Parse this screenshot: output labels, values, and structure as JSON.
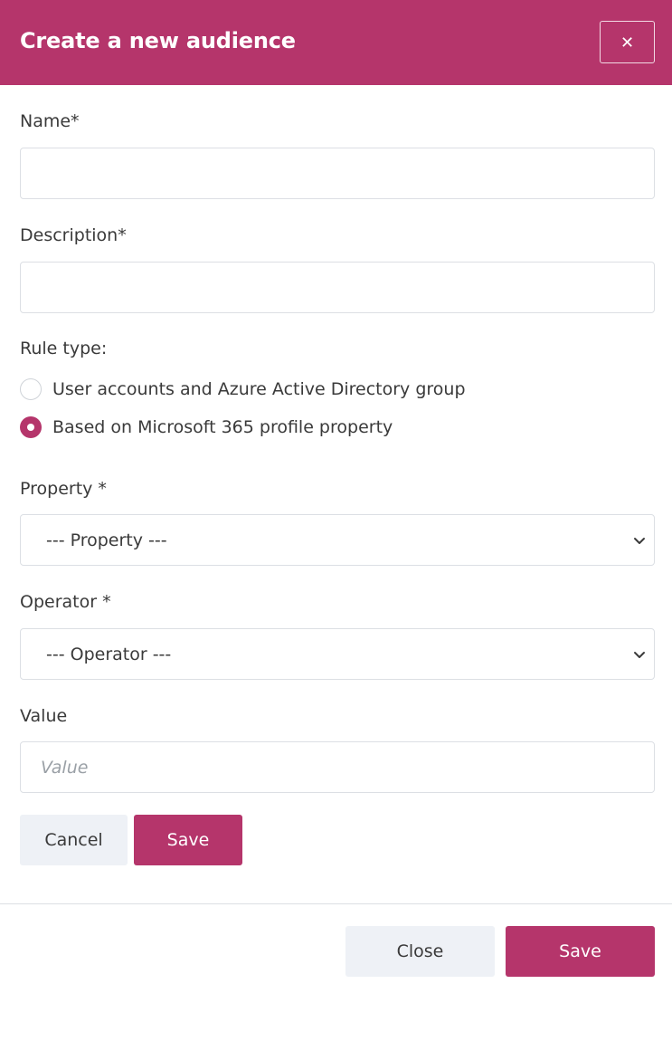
{
  "header": {
    "title": "Create a new audience",
    "close_glyph": "✕",
    "accent_color": "#b5356b"
  },
  "form": {
    "name": {
      "label": "Name*",
      "value": ""
    },
    "description": {
      "label": "Description*",
      "value": ""
    },
    "rule_type": {
      "label": "Rule type:",
      "options": [
        {
          "label": "User accounts and Azure Active Directory group",
          "checked": false
        },
        {
          "label": "Based on Microsoft 365 profile property",
          "checked": true
        }
      ]
    },
    "property": {
      "label": "Property *",
      "selected": "--- Property ---"
    },
    "operator": {
      "label": "Operator *",
      "selected": "--- Operator ---"
    },
    "value": {
      "label": "Value",
      "placeholder": "Value"
    },
    "rule_actions": {
      "cancel_label": "Cancel",
      "save_label": "Save"
    }
  },
  "footer": {
    "close_label": "Close",
    "save_label": "Save"
  },
  "icons": {
    "close": "close-icon",
    "chevron": "chevron-down-icon"
  }
}
